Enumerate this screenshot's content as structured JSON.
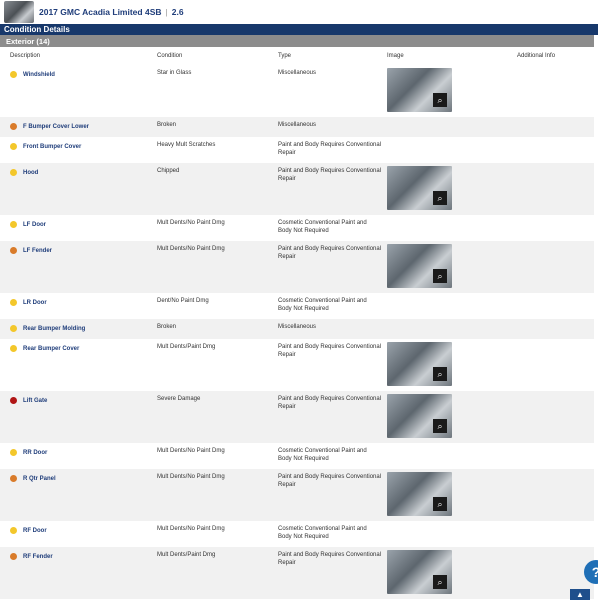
{
  "header": {
    "vehicle_title": "2017 GMC Acadia Limited 4SB",
    "separator": "|",
    "version": "2.6"
  },
  "section": {
    "title": "Condition Details"
  },
  "group": {
    "title": "Exterior (14)"
  },
  "columns": {
    "description": "Description",
    "condition": "Condition",
    "type": "Type",
    "image": "Image",
    "additional": "Additional Info"
  },
  "severity_colors": {
    "minor": "#f3c72b",
    "moderate": "#d97b2a",
    "severe": "#b01515"
  },
  "rows": [
    {
      "desc": "Windshield",
      "condition": "Star in Glass",
      "type": "Miscellaneous",
      "severity": "minor",
      "has_image": true
    },
    {
      "desc": "F Bumper Cover Lower",
      "condition": "Broken",
      "type": "Miscellaneous",
      "severity": "moderate",
      "has_image": false
    },
    {
      "desc": "Front Bumper Cover",
      "condition": "Heavy Mult Scratches",
      "type": "Paint and Body Requires Conventional Repair",
      "severity": "minor",
      "has_image": false
    },
    {
      "desc": "Hood",
      "condition": "Chipped",
      "type": "Paint and Body Requires Conventional Repair",
      "severity": "minor",
      "has_image": true
    },
    {
      "desc": "LF Door",
      "condition": "Mult Dents/No Paint Dmg",
      "type": "Cosmetic Conventional Paint and Body Not Required",
      "severity": "minor",
      "has_image": false
    },
    {
      "desc": "LF Fender",
      "condition": "Mult Dents/No Paint Dmg",
      "type": "Paint and Body Requires Conventional Repair",
      "severity": "moderate",
      "has_image": true
    },
    {
      "desc": "LR Door",
      "condition": "Dent/No Paint Dmg",
      "type": "Cosmetic Conventional Paint and Body Not Required",
      "severity": "minor",
      "has_image": false
    },
    {
      "desc": "Rear Bumper Molding",
      "condition": "Broken",
      "type": "Miscellaneous",
      "severity": "minor",
      "has_image": false
    },
    {
      "desc": "Rear Bumper Cover",
      "condition": "Mult Dents/Paint Dmg",
      "type": "Paint and Body Requires Conventional Repair",
      "severity": "minor",
      "has_image": true
    },
    {
      "desc": "Lift Gate",
      "condition": "Severe Damage",
      "type": "Paint and Body Requires Conventional Repair",
      "severity": "severe",
      "has_image": true
    },
    {
      "desc": "RR Door",
      "condition": "Mult Dents/No Paint Dmg",
      "type": "Cosmetic Conventional Paint and Body Not Required",
      "severity": "minor",
      "has_image": false
    },
    {
      "desc": "R Qtr Panel",
      "condition": "Mult Dents/No Paint Dmg",
      "type": "Paint and Body Requires Conventional Repair",
      "severity": "moderate",
      "has_image": true
    },
    {
      "desc": "RF Door",
      "condition": "Mult Dents/No Paint Dmg",
      "type": "Cosmetic Conventional Paint and Body Not Required",
      "severity": "minor",
      "has_image": false
    },
    {
      "desc": "RF Fender",
      "condition": "Mult Dents/Paint Dmg",
      "type": "Paint and Body Requires Conventional Repair",
      "severity": "moderate",
      "has_image": true
    }
  ],
  "icons": {
    "zoom": "magnify-icon",
    "help": "help-icon",
    "scroll_top": "chevron-up-icon"
  }
}
